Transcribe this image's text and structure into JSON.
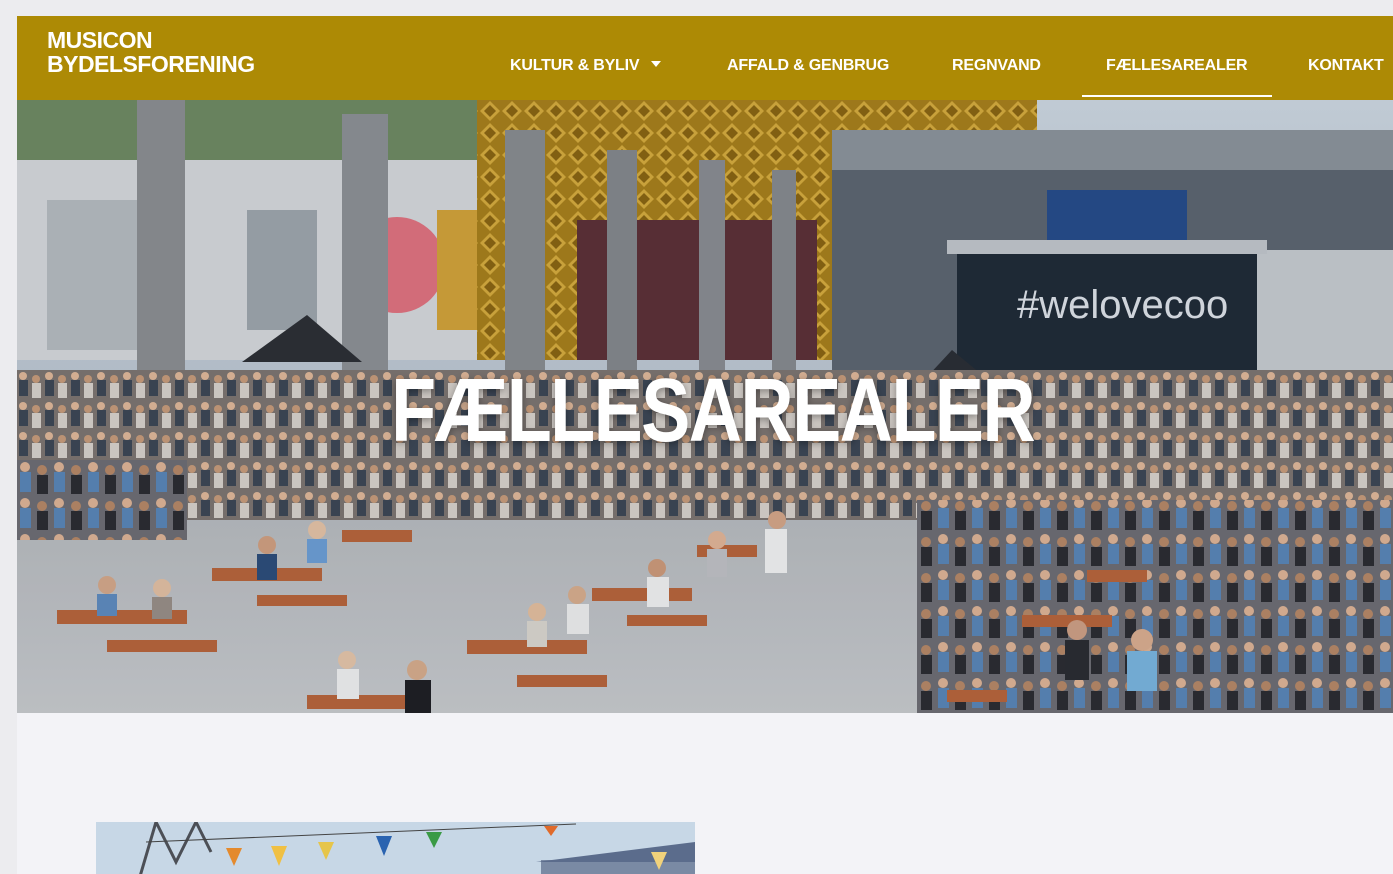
{
  "brand": {
    "line1": "MUSICON",
    "line2": "BYDELSFORENING"
  },
  "nav": {
    "items": [
      {
        "label": "KULTUR & BYLIV",
        "has_dropdown": true
      },
      {
        "label": "AFFALD & GENBRUG"
      },
      {
        "label": "REGNVAND"
      },
      {
        "label": "FÆLLESAREALER",
        "active": true
      },
      {
        "label": "KONTAKT"
      }
    ]
  },
  "hero": {
    "title": "FÆLLESAREALER",
    "stage_banner": "#welovecoo"
  },
  "colors": {
    "header_bg": "#ad8a05",
    "page_bg": "#f3f3f7",
    "text_on_header": "#ffffff"
  }
}
